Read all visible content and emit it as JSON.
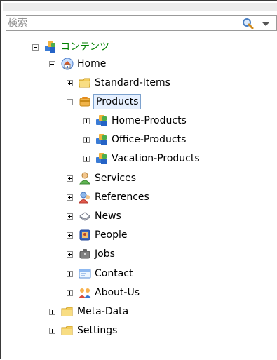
{
  "search": {
    "placeholder": "検索"
  },
  "tree": {
    "root": {
      "label": "コンテンツ",
      "icon": "tree-root-icon",
      "expanded": true,
      "color": "#008000"
    },
    "home": {
      "label": "Home",
      "icon": "home-icon",
      "expanded": true
    },
    "standard_items": {
      "label": "Standard-Items",
      "icon": "folder-icon",
      "expanded": false
    },
    "products": {
      "label": "Products",
      "icon": "products-icon",
      "expanded": true,
      "selected": true
    },
    "home_products": {
      "label": "Home-Products",
      "icon": "tree-root-icon",
      "expanded": false
    },
    "office_products": {
      "label": "Office-Products",
      "icon": "tree-root-icon",
      "expanded": false
    },
    "vacation_products": {
      "label": "Vacation-Products",
      "icon": "tree-root-icon",
      "expanded": false
    },
    "services": {
      "label": "Services",
      "icon": "user-icon",
      "expanded": false
    },
    "references": {
      "label": "References",
      "icon": "references-icon",
      "expanded": false
    },
    "news": {
      "label": "News",
      "icon": "news-icon",
      "expanded": false
    },
    "people": {
      "label": "People",
      "icon": "people-icon",
      "expanded": false
    },
    "jobs": {
      "label": "Jobs",
      "icon": "jobs-icon",
      "expanded": false
    },
    "contact": {
      "label": "Contact",
      "icon": "contact-icon",
      "expanded": false
    },
    "about_us": {
      "label": "About-Us",
      "icon": "group-icon",
      "expanded": false
    },
    "meta_data": {
      "label": "Meta-Data",
      "icon": "folder-icon",
      "expanded": false
    },
    "settings": {
      "label": "Settings",
      "icon": "folder-icon",
      "expanded": false
    }
  },
  "colors": {
    "selection_bg": "#e6f0ff",
    "selection_border": "#7da2ce",
    "root_label": "#008000"
  }
}
